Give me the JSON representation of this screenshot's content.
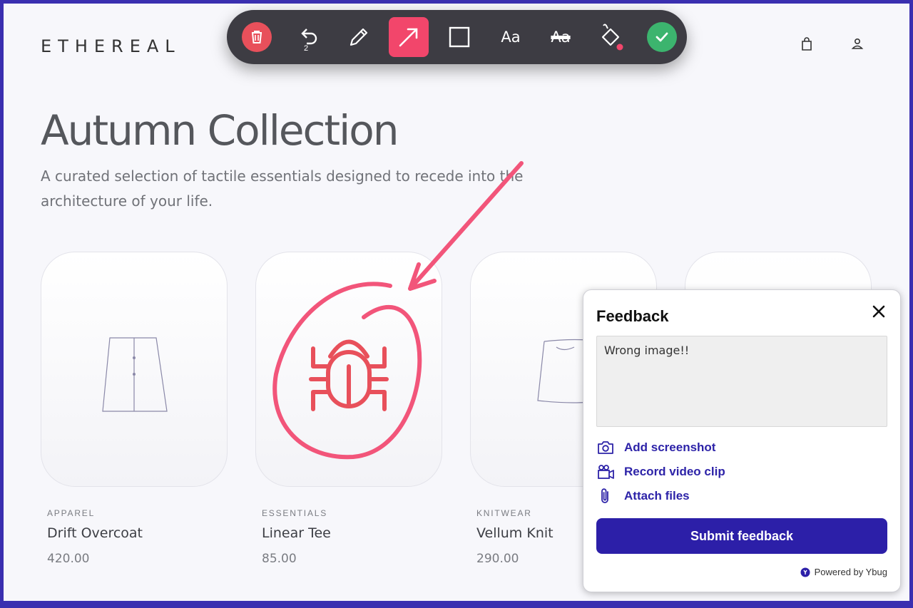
{
  "store": {
    "brand": "ETHEREAL",
    "page_title": "Autumn Collection",
    "subtitle": "A curated selection of tactile essentials designed to recede into the architecture of your life.",
    "header_icons": [
      "shopping-bag-icon",
      "user-icon"
    ]
  },
  "products": [
    {
      "category": "APPAREL",
      "name": "Drift Overcoat",
      "price": "420.00",
      "image_icon": "coat-outline-icon"
    },
    {
      "category": "ESSENTIALS",
      "name": "Linear Tee",
      "price": "85.00",
      "image_icon": "bug-icon"
    },
    {
      "category": "KNITWEAR",
      "name": "Vellum Knit",
      "price": "290.00",
      "image_icon": "knit-outline-icon"
    }
  ],
  "toolbar": {
    "tools": [
      "trash-icon",
      "undo-icon",
      "pencil-icon",
      "arrow-icon",
      "rectangle-icon",
      "text-icon",
      "strikethrough-text-icon",
      "fill-bucket-icon",
      "confirm-icon"
    ],
    "active_tool": "arrow-icon",
    "undo_count": "2",
    "text_tool_label": "Aa",
    "strike_tool_label": "Aa",
    "colors": {
      "toolbar_bg": "#3d3c43",
      "active": "#f2466b",
      "trash": "#e8505b",
      "confirm": "#3cb46e",
      "annotation": "#f2557a"
    }
  },
  "feedback": {
    "title": "Feedback",
    "text": "Wrong image!!",
    "actions": [
      {
        "label": "Add screenshot",
        "icon": "camera-icon"
      },
      {
        "label": "Record video clip",
        "icon": "video-camera-icon"
      },
      {
        "label": "Attach files",
        "icon": "paperclip-icon"
      }
    ],
    "submit_label": "Submit feedback",
    "powered_by": "Powered by Ybug",
    "accent": "#2c1fa8"
  }
}
